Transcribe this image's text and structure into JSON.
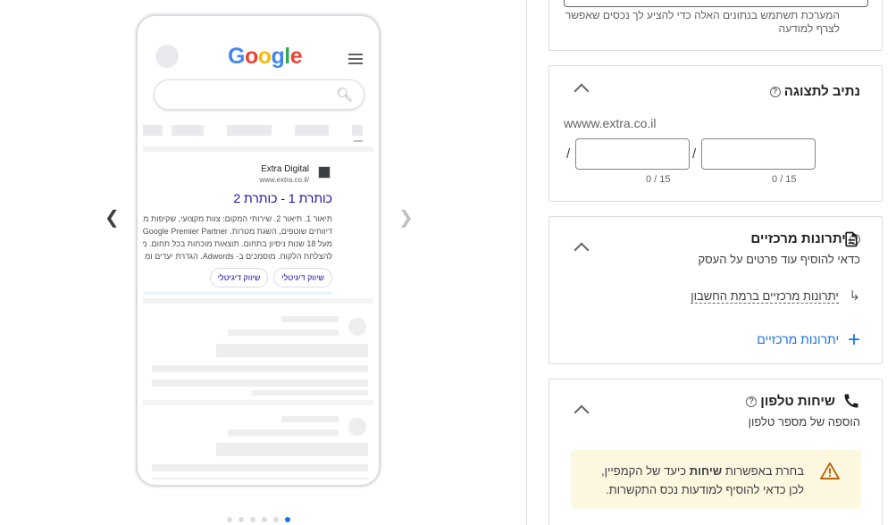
{
  "preview": {
    "google_logo": "Google",
    "advertiser_name": "Extra Digital",
    "advertiser_url": "www.extra.co.il/",
    "ad_title": "כותרת 1 - כותרת 2",
    "ad_description_lines": [
      "תיאור 1. תיאור 2. שירותי המקום: צוות מקצועי, שקיפות מ",
      "דיווחים שוטפים, השגת מטרות. Google Premier Partner",
      "מעל 18 שנות ניסיון בתחום. תוצאות מוכחות בכל תחום. מ",
      "להצלחת הלקוח. מוסמכים ב- Adwords. הגדרת יעדים ומ"
    ],
    "sitelinks": [
      "שיווק דיגיטלי",
      "שיווק דיגיטלי"
    ],
    "dots_count": 6,
    "active_dot": 5
  },
  "top_card": {
    "hint": "המערכת תשתמש בנתונים האלה כדי להציע לך נכסים שאפשר לצרף למודעה"
  },
  "display_path": {
    "title": "נתיב לתצוגה",
    "base_url": "wwww.extra.co.il",
    "path1_value": "",
    "path2_value": "",
    "path1_counter": "0 / 15",
    "path2_counter": "0 / 15",
    "separator": "/"
  },
  "callouts": {
    "title": "יתרונות מרכזיים",
    "subtitle": "כדאי להוסיף עוד פרטים על העסק",
    "account_link": "יתרונות מרכזיים ברמת החשבון",
    "add_label": "יתרונות מרכזיים"
  },
  "calls": {
    "title": "שיחות טלפון",
    "subtitle": "הוספה של מספר טלפון",
    "warning_pre": "בחרת באפשרות ",
    "warning_bold": "שיחות",
    "warning_post": " כיעד של הקמפיין,",
    "warning_line2": "לכן כדאי להוסיף למודעות נכס התקשרות."
  },
  "colors": {
    "accent": "#1a73e8",
    "link": "#1a0dab",
    "warning_bg": "#fef7e0",
    "warning_icon": "#b06000"
  }
}
